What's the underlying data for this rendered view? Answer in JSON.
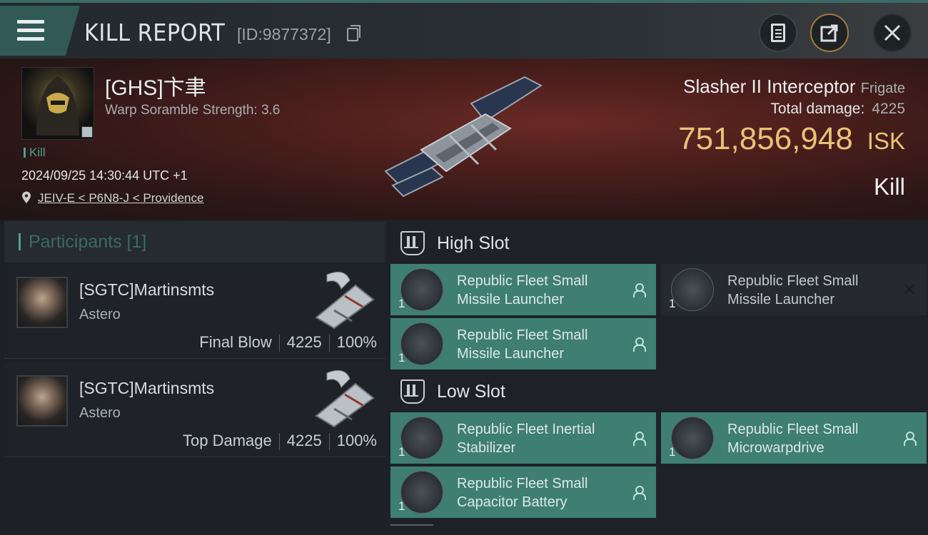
{
  "header": {
    "title": "KILL REPORT",
    "report_id": "[ID:9877372]",
    "menu_icon": "menu-icon",
    "buttons": [
      "clipboard-icon",
      "share-icon",
      "close-icon"
    ]
  },
  "victim": {
    "name": "[GHS]卞聿",
    "warp_scramble": "Warp Soramble Strength: 3.6",
    "kill_tag": "Kill",
    "datetime": "2024/09/25 14:30:44 UTC +1",
    "location": "JEIV-E < P6N8-J < Providence",
    "ship_name": "Slasher II Interceptor",
    "ship_class": "Frigate",
    "total_damage_label": "Total damage:",
    "total_damage_value": "4225",
    "isk_value": "751,856,948",
    "isk_currency": "ISK",
    "result": "Kill"
  },
  "participants": {
    "title": "Participants [1]",
    "rows": [
      {
        "name": "[SGTC]Martinsmts",
        "ship": "Astero",
        "role": "Final Blow",
        "damage": "4225",
        "percent": "100%"
      },
      {
        "name": "[SGTC]Martinsmts",
        "ship": "Astero",
        "role": "Top Damage",
        "damage": "4225",
        "percent": "100%"
      }
    ]
  },
  "slots": {
    "high": {
      "label": "High Slot",
      "modules": [
        {
          "line1": "Republic Fleet Small",
          "line2": "Missile Launcher",
          "qty": "1"
        },
        {
          "line1": "Republic Fleet Small",
          "line2": "Missile Launcher",
          "qty": "1"
        },
        {
          "line1": "Republic Fleet Small",
          "line2": "Missile Launcher",
          "qty": "1"
        }
      ]
    },
    "low": {
      "label": "Low Slot",
      "modules": [
        {
          "line1": "Republic Fleet Inertial",
          "line2": "Stabilizer",
          "qty": "1"
        },
        {
          "line1": "Republic Fleet Small",
          "line2": "Microwarpdrive",
          "qty": "1"
        },
        {
          "line1": "Republic Fleet Small",
          "line2": "Capacitor Battery",
          "qty": "1"
        }
      ]
    }
  },
  "colors": {
    "accent": "#4fa08f",
    "module_fitted": "#3e7e73",
    "isk": "#e9c277"
  }
}
